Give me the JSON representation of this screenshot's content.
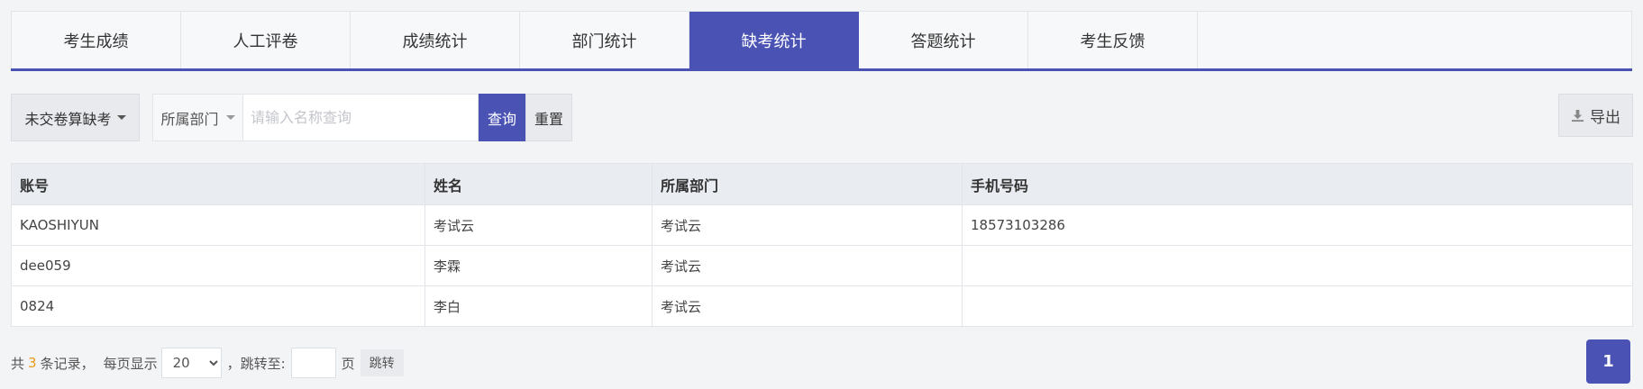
{
  "tabs": [
    {
      "label": "考生成绩"
    },
    {
      "label": "人工评卷"
    },
    {
      "label": "成绩统计"
    },
    {
      "label": "部门统计"
    },
    {
      "label": "缺考统计",
      "active": true
    },
    {
      "label": "答题统计"
    },
    {
      "label": "考生反馈"
    }
  ],
  "toolbar": {
    "absent_filter": "未交卷算缺考",
    "dept_select": "所属部门",
    "search_placeholder": "请输入名称查询",
    "query_label": "查询",
    "reset_label": "重置",
    "export_label": "导出"
  },
  "table": {
    "headers": [
      "账号",
      "姓名",
      "所属部门",
      "手机号码"
    ],
    "rows": [
      [
        "KAOSHIYUN",
        "考试云",
        "考试云",
        "18573103286"
      ],
      [
        "dee059",
        "李霖",
        "考试云",
        ""
      ],
      [
        "0824",
        "李白",
        "考试云",
        ""
      ]
    ]
  },
  "pagination": {
    "total_prefix": "共",
    "total": "3",
    "total_suffix": "条记录，",
    "per_page_label": "每页显示",
    "per_page": "20",
    "jump_label": "，跳转至:",
    "page_unit": "页",
    "jump_button": "跳转",
    "current_page": "1"
  },
  "colors": {
    "accent": "#4a53b4",
    "count": "#e89a1c"
  }
}
